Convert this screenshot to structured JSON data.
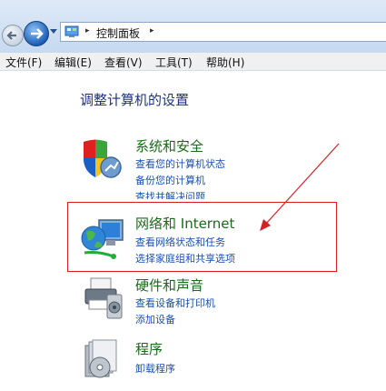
{
  "address": {
    "path": "控制面板",
    "sep": "▸"
  },
  "menu": [
    "文件(F)",
    "编辑(E)",
    "查看(V)",
    "工具(T)",
    "帮助(H)"
  ],
  "page_title": "调整计算机的设置",
  "categories": [
    {
      "title": "系统和安全",
      "icon": "shield-icon",
      "links": [
        "查看您的计算机状态",
        "备份您的计算机",
        "查找并解决问题"
      ]
    },
    {
      "title": "网络和 Internet",
      "icon": "network-globe-icon",
      "links": [
        "查看网络状态和任务",
        "选择家庭组和共享选项"
      ]
    },
    {
      "title": "硬件和声音",
      "icon": "printer-icon",
      "links": [
        "查看设备和打印机",
        "添加设备"
      ]
    },
    {
      "title": "程序",
      "icon": "programs-icon",
      "links": [
        "卸载程序"
      ]
    }
  ],
  "colors": {
    "category_title": "#1b6a1b",
    "link": "#1a4fb0",
    "page_title": "#1e3287",
    "highlight": "#d81e1e"
  }
}
